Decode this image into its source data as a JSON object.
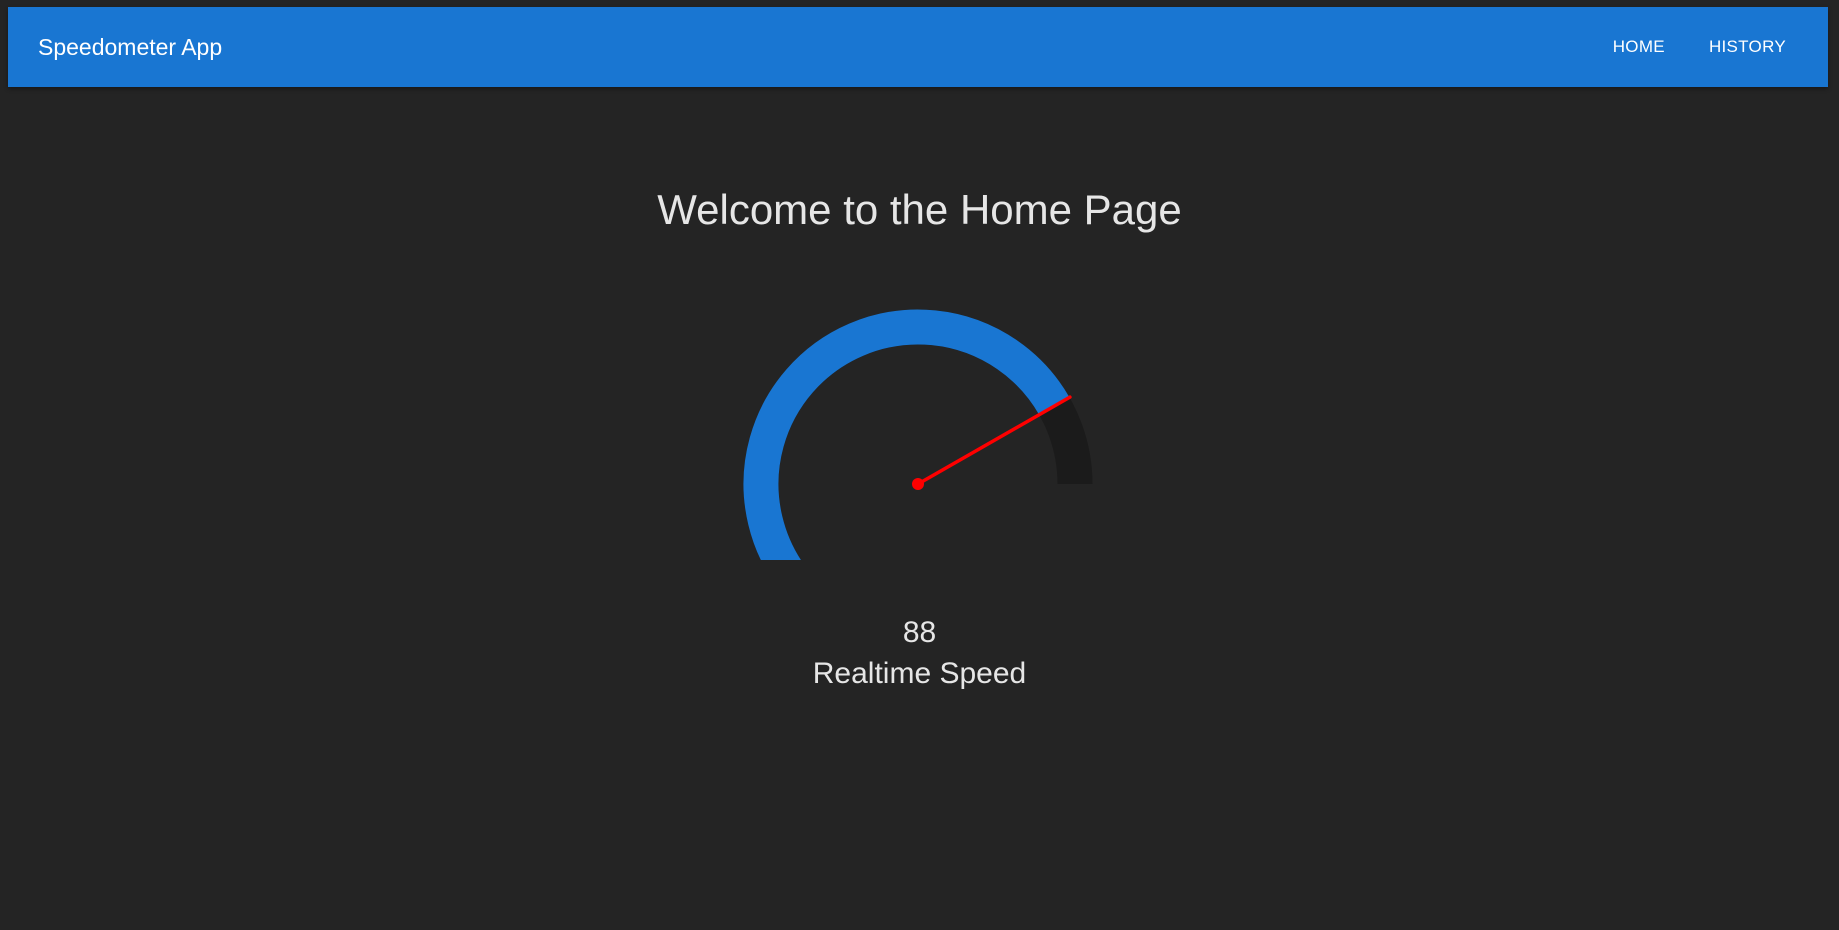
{
  "app": {
    "title": "Speedometer App"
  },
  "nav": {
    "home_label": "HOME",
    "history_label": "HISTORY"
  },
  "main": {
    "page_title": "Welcome to the Home Page",
    "speed_value": "88",
    "speed_label": "Realtime Speed"
  },
  "gauge": {
    "value": 88,
    "min": 0,
    "max": 100,
    "fill_color": "#1976d2",
    "track_color": "#1b1b1b",
    "needle_color": "#ff0000"
  },
  "colors": {
    "appbar": "#1976d2",
    "background": "#242424",
    "text": "#e6e6e6"
  }
}
